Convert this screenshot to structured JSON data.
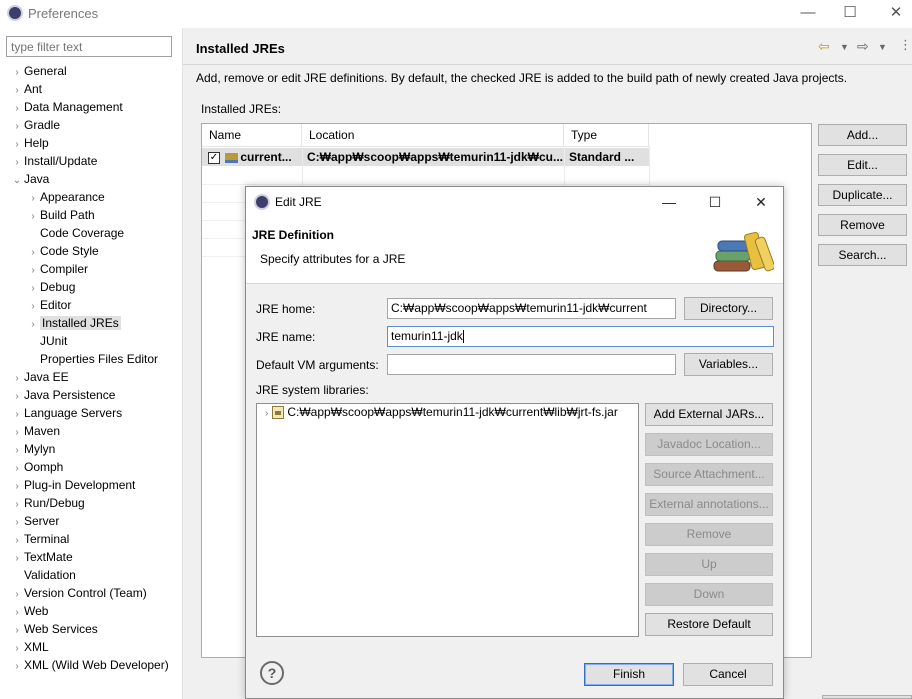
{
  "window": {
    "title": "Preferences",
    "controls": [
      "—",
      "☐",
      "✕"
    ]
  },
  "filter": {
    "placeholder": "type filter text"
  },
  "tree": [
    {
      "label": "General",
      "chevron": "›",
      "level": 0
    },
    {
      "label": "Ant",
      "chevron": "›",
      "level": 0
    },
    {
      "label": "Data Management",
      "chevron": "›",
      "level": 0
    },
    {
      "label": "Gradle",
      "chevron": "›",
      "level": 0
    },
    {
      "label": "Help",
      "chevron": "›",
      "level": 0
    },
    {
      "label": "Install/Update",
      "chevron": "›",
      "level": 0
    },
    {
      "label": "Java",
      "chevron": "⌄",
      "level": 0
    },
    {
      "label": "Appearance",
      "chevron": "›",
      "level": 1
    },
    {
      "label": "Build Path",
      "chevron": "›",
      "level": 1
    },
    {
      "label": "Code Coverage",
      "chevron": "",
      "level": 1
    },
    {
      "label": "Code Style",
      "chevron": "›",
      "level": 1
    },
    {
      "label": "Compiler",
      "chevron": "›",
      "level": 1
    },
    {
      "label": "Debug",
      "chevron": "›",
      "level": 1
    },
    {
      "label": "Editor",
      "chevron": "›",
      "level": 1
    },
    {
      "label": "Installed JREs",
      "chevron": "›",
      "level": 1,
      "selected": true
    },
    {
      "label": "JUnit",
      "chevron": "",
      "level": 1
    },
    {
      "label": "Properties Files Editor",
      "chevron": "",
      "level": 1
    },
    {
      "label": "Java EE",
      "chevron": "›",
      "level": 0
    },
    {
      "label": "Java Persistence",
      "chevron": "›",
      "level": 0
    },
    {
      "label": "Language Servers",
      "chevron": "›",
      "level": 0
    },
    {
      "label": "Maven",
      "chevron": "›",
      "level": 0
    },
    {
      "label": "Mylyn",
      "chevron": "›",
      "level": 0
    },
    {
      "label": "Oomph",
      "chevron": "›",
      "level": 0
    },
    {
      "label": "Plug-in Development",
      "chevron": "›",
      "level": 0
    },
    {
      "label": "Run/Debug",
      "chevron": "›",
      "level": 0
    },
    {
      "label": "Server",
      "chevron": "›",
      "level": 0
    },
    {
      "label": "Terminal",
      "chevron": "›",
      "level": 0
    },
    {
      "label": "TextMate",
      "chevron": "›",
      "level": 0
    },
    {
      "label": "Validation",
      "chevron": "",
      "level": 0
    },
    {
      "label": "Version Control (Team)",
      "chevron": "›",
      "level": 0
    },
    {
      "label": "Web",
      "chevron": "›",
      "level": 0
    },
    {
      "label": "Web Services",
      "chevron": "›",
      "level": 0
    },
    {
      "label": "XML",
      "chevron": "›",
      "level": 0
    },
    {
      "label": "XML (Wild Web Developer)",
      "chevron": "›",
      "level": 0
    }
  ],
  "page": {
    "title": "Installed JREs",
    "description": "Add, remove or edit JRE definitions. By default, the checked JRE is added to the build path of newly created Java projects.",
    "list_label": "Installed JREs:",
    "columns": [
      "Name",
      "Location",
      "Type"
    ],
    "rows": [
      {
        "checked": true,
        "name": "current...",
        "location": "C:₩app₩scoop₩apps₩temurin11-jdk₩cu...",
        "type": "Standard ..."
      }
    ],
    "buttons": {
      "add": "Add...",
      "edit": "Edit...",
      "duplicate": "Duplicate...",
      "remove": "Remove",
      "search": "Search..."
    }
  },
  "dialog": {
    "title": "Edit JRE",
    "header_title": "JRE Definition",
    "header_subtitle": "Specify attributes for a JRE",
    "jre_home_label": "JRE home:",
    "jre_home_value": "C:₩app₩scoop₩apps₩temurin11-jdk₩current",
    "directory_button": "Directory...",
    "jre_name_label": "JRE name:",
    "jre_name_value": "temurin11-jdk",
    "vm_args_label": "Default VM arguments:",
    "vm_args_value": "",
    "variables_button": "Variables...",
    "libs_label": "JRE system libraries:",
    "library": "C:₩app₩scoop₩apps₩temurin11-jdk₩current₩lib₩jrt-fs.jar",
    "lib_buttons": {
      "add_external": "Add External JARs...",
      "javadoc": "Javadoc Location...",
      "source": "Source Attachment...",
      "annotations": "External annotations...",
      "remove": "Remove",
      "up": "Up",
      "down": "Down",
      "restore": "Restore Default"
    },
    "help": "?",
    "finish": "Finish",
    "cancel": "Cancel"
  }
}
